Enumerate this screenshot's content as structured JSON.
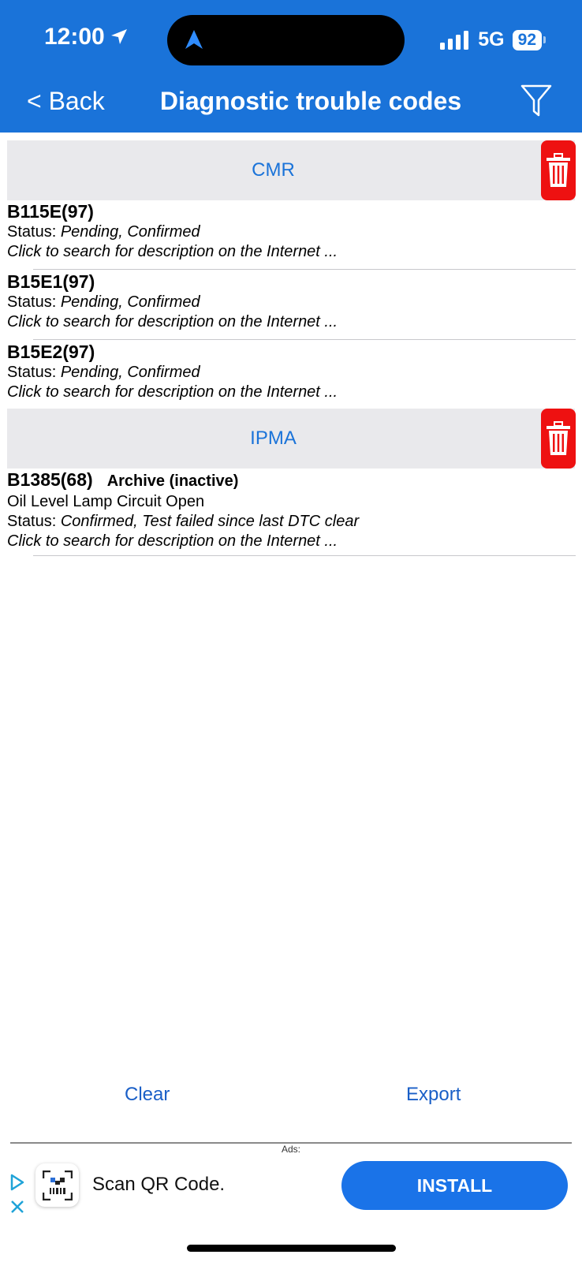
{
  "status_bar": {
    "time": "12:00",
    "network": "5G",
    "battery": "92"
  },
  "nav": {
    "back_label": "< Back",
    "title": "Diagnostic trouble codes"
  },
  "sections": [
    {
      "label": "CMR",
      "entries": [
        {
          "code": "B115E(97)",
          "status_prefix": "Status:",
          "status": "Pending, Confirmed",
          "link": "Click to search for description on the Internet ..."
        },
        {
          "code": "B15E1(97)",
          "status_prefix": "Status:",
          "status": "Pending, Confirmed",
          "link": "Click to search for description on the Internet ..."
        },
        {
          "code": "B15E2(97)",
          "status_prefix": "Status:",
          "status": "Pending, Confirmed",
          "link": "Click to search for description on the Internet ..."
        }
      ]
    },
    {
      "label": "IPMA",
      "entries": [
        {
          "code": "B1385(68)",
          "archive": "Archive (inactive)",
          "description": "Oil Level Lamp Circuit Open",
          "status_prefix": "Status:",
          "status": "Confirmed, Test failed since last DTC clear",
          "link": "Click to search for description on the Internet ..."
        }
      ]
    }
  ],
  "actions": {
    "clear": "Clear",
    "export": "Export"
  },
  "ad": {
    "label": "Ads:",
    "text": "Scan QR Code.",
    "install": "INSTALL"
  },
  "colors": {
    "header": "#1a73d9",
    "accent": "#1a73d9",
    "delete": "#ee1111",
    "install": "#1a73e8"
  }
}
